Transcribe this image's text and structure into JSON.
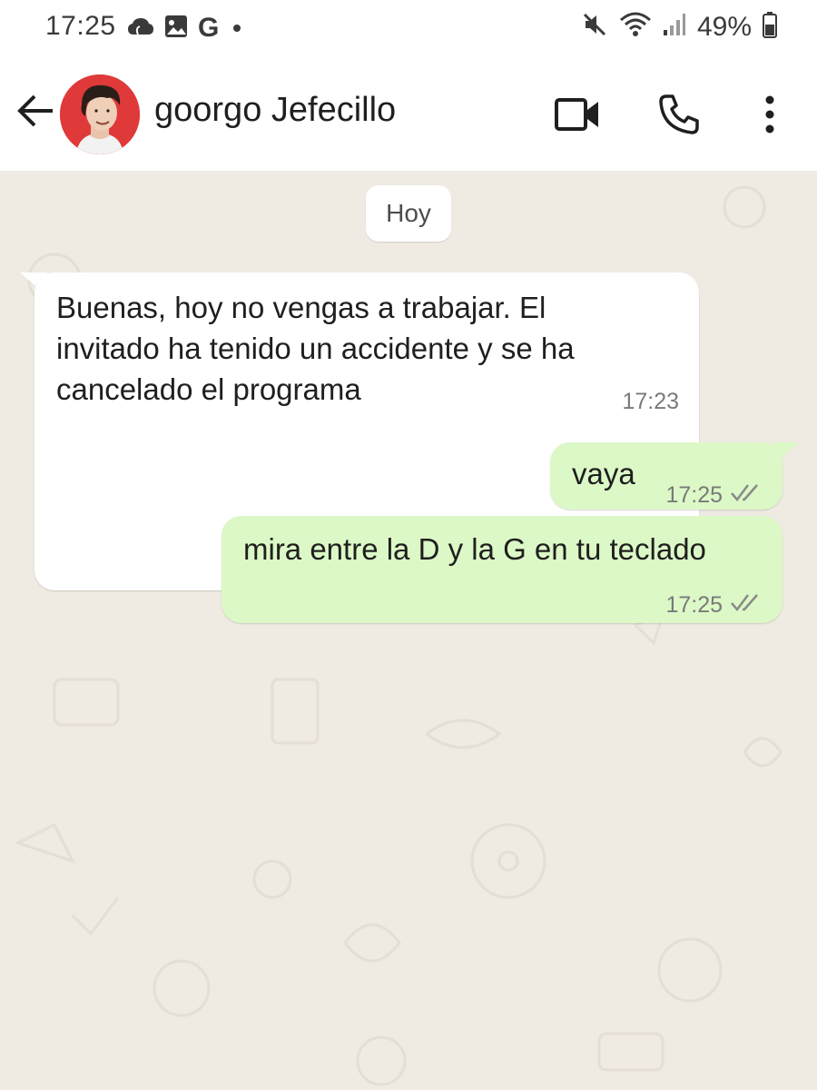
{
  "status_bar": {
    "time": "17:25",
    "left_icons": [
      "cloud-icon",
      "gallery-icon",
      "google-icon",
      "dot-icon"
    ],
    "google_letter": "G",
    "right_icons": [
      "mute-icon",
      "wifi-icon",
      "signal-icon",
      "battery-icon"
    ],
    "battery": "49%"
  },
  "header": {
    "contact_name": "goorgo Jefecillo",
    "actions": [
      "back-arrow-icon",
      "video-call-icon",
      "phone-icon",
      "more-vert-icon"
    ]
  },
  "chat": {
    "date_chip": "Hoy",
    "messages": [
      {
        "direction": "incoming",
        "lines": [
          "Buenas, hoy no vengas a trabajar. El",
          "invitado ha tenido un accidente y se ha",
          "cancelado el programa"
        ],
        "time": "17:23"
      },
      {
        "direction": "outgoing",
        "lines": [
          "vaya"
        ],
        "time": "17:25",
        "status": "double-check-icon"
      },
      {
        "direction": "outgoing",
        "lines": [
          "mira entre la D y la G en tu teclado"
        ],
        "time": "17:25",
        "status": "double-check-icon"
      }
    ]
  },
  "colors": {
    "chat_background": "#efeae2",
    "incoming_bubble": "#ffffff",
    "outgoing_bubble": "#dcf8c6",
    "avatar_background": "#e0393a",
    "text": "#1f1f1f",
    "meta_text": "#7a7a7a"
  }
}
